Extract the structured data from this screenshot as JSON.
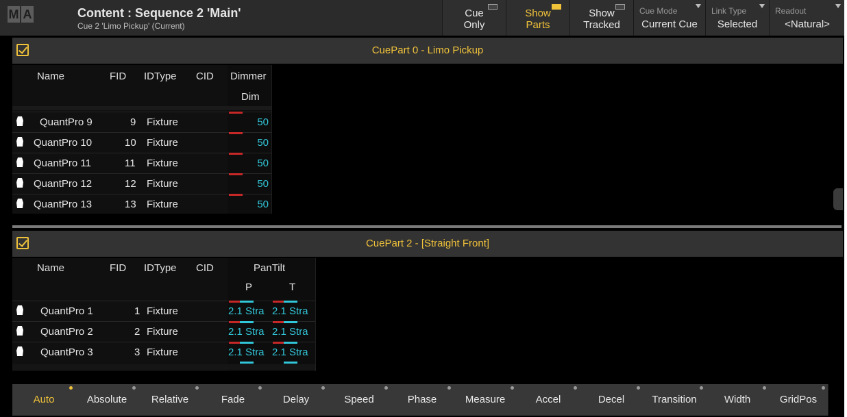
{
  "header": {
    "logo": [
      "M",
      "A"
    ],
    "title": "Content : Sequence 2 'Main'",
    "subtitle": "Cue 2 'Limo Pickup' (Current)",
    "buttons": [
      {
        "l1": "Cue",
        "l2": "Only",
        "active": false
      },
      {
        "l1": "Show",
        "l2": "Parts",
        "active": true
      },
      {
        "l1": "Show",
        "l2": "Tracked",
        "active": false
      }
    ],
    "selectors": [
      {
        "label": "Cue Mode",
        "value": "Current Cue"
      },
      {
        "label": "Link Type",
        "value": "Selected"
      },
      {
        "label": "Readout",
        "value": "<Natural>"
      }
    ]
  },
  "part0": {
    "title": "CuePart 0 - Limo Pickup",
    "headers": {
      "name": "Name",
      "fid": "FID",
      "idtype": "IDType",
      "cid": "CID",
      "attr": "Dimmer",
      "sub": "Dim"
    },
    "rows": [
      {
        "name": "QuantPro 9",
        "fid": "9",
        "idtype": "Fixture",
        "value": "50"
      },
      {
        "name": "QuantPro 10",
        "fid": "10",
        "idtype": "Fixture",
        "value": "50"
      },
      {
        "name": "QuantPro 11",
        "fid": "11",
        "idtype": "Fixture",
        "value": "50"
      },
      {
        "name": "QuantPro 12",
        "fid": "12",
        "idtype": "Fixture",
        "value": "50"
      },
      {
        "name": "QuantPro 13",
        "fid": "13",
        "idtype": "Fixture",
        "value": "50"
      }
    ]
  },
  "part2": {
    "title": "CuePart 2 - [Straight Front]",
    "headers": {
      "name": "Name",
      "fid": "FID",
      "idtype": "IDType",
      "cid": "CID",
      "attr": "PanTilt",
      "p": "P",
      "t": "T"
    },
    "rows": [
      {
        "name": "QuantPro 1",
        "fid": "1",
        "idtype": "Fixture",
        "p": "2.1 Stra",
        "t": "2.1 Stra"
      },
      {
        "name": "QuantPro 2",
        "fid": "2",
        "idtype": "Fixture",
        "p": "2.1 Stra",
        "t": "2.1 Stra"
      },
      {
        "name": "QuantPro 3",
        "fid": "3",
        "idtype": "Fixture",
        "p": "2.1 Stra",
        "t": "2.1 Stra"
      }
    ]
  },
  "bottom": {
    "items": [
      "Auto",
      "Absolute",
      "Relative",
      "Fade",
      "Delay",
      "Speed",
      "Phase",
      "Measure",
      "Accel",
      "Decel",
      "Transition",
      "Width",
      "GridPos"
    ],
    "active": "Auto"
  },
  "colors": {
    "accent": "#f0c23a",
    "value": "#31c6d8",
    "tracked": "#c62828",
    "panel": "#333333"
  }
}
